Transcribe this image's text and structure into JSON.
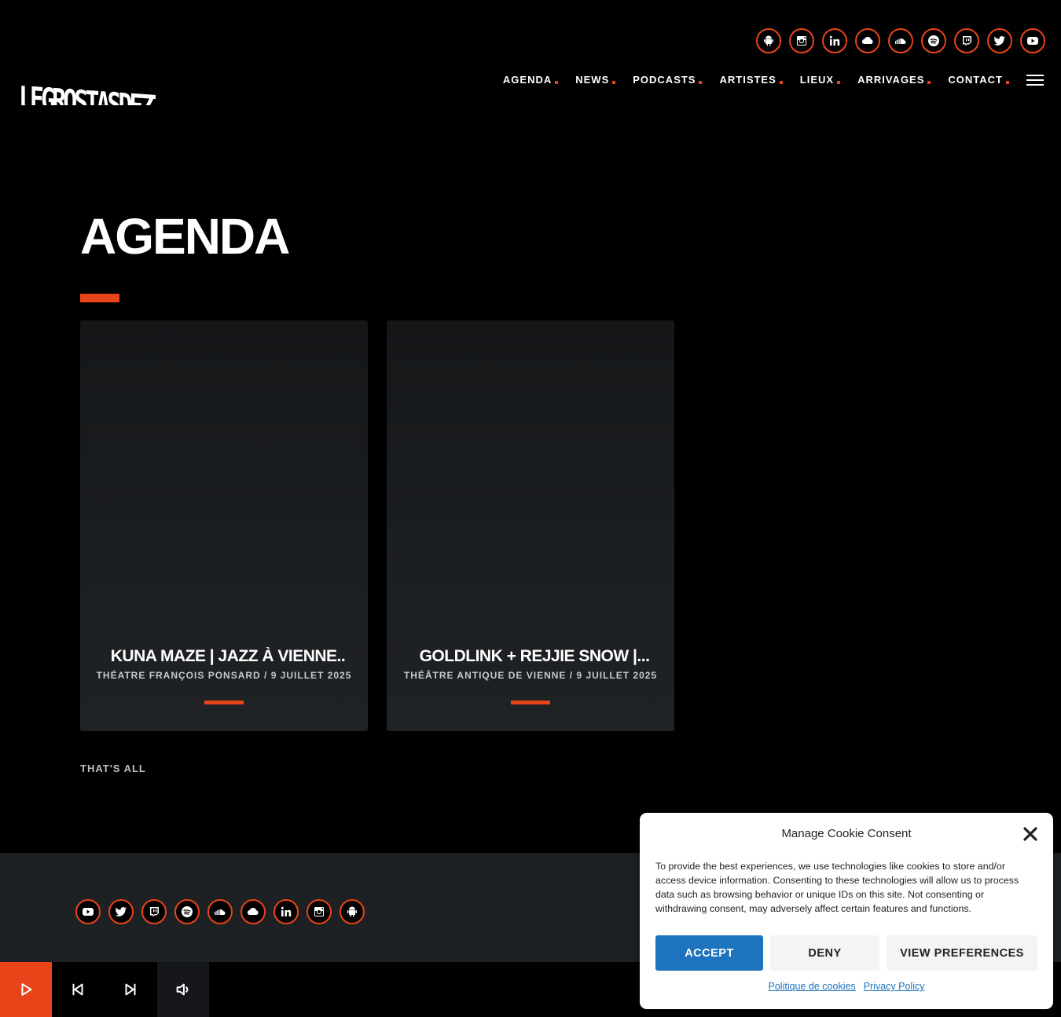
{
  "header": {
    "logo_text": "LEGROSTASDEZIK",
    "social": [
      "android-icon",
      "instagram-icon",
      "linkedin-icon",
      "mixcloud-icon",
      "soundcloud-icon",
      "spotify-icon",
      "twitch-icon",
      "twitter-icon",
      "youtube-icon"
    ],
    "nav": [
      "AGENDA",
      "NEWS",
      "PODCASTS",
      "ARTISTES",
      "LIEUX",
      "ARRIVAGES",
      "CONTACT"
    ]
  },
  "main": {
    "title": "AGENDA",
    "cards": [
      {
        "title": "KUNA MAZE | JAZZ À VIENNE..",
        "subtitle": "THÉATRE FRANÇOIS PONSARD / 9 JUILLET 2025"
      },
      {
        "title": "GOLDLINK + REJJIE SNOW |...",
        "subtitle": "THÉÂTRE ANTIQUE DE VIENNE / 9 JUILLET 2025"
      }
    ],
    "end_text": "THAT'S ALL"
  },
  "footer": {
    "social": [
      "youtube-icon",
      "twitter-icon",
      "twitch-icon",
      "spotify-icon",
      "soundcloud-icon",
      "mixcloud-icon",
      "linkedin-icon",
      "instagram-icon",
      "android-icon"
    ]
  },
  "cookie": {
    "title": "Manage Cookie Consent",
    "text": "To provide the best experiences, we use technologies like cookies to store and/or access device information. Consenting to these technologies will allow us to process data such as browsing behavior or unique IDs on this site. Not consenting or withdrawing consent, may adversely affect certain features and functions.",
    "accept": "ACCEPT",
    "deny": "DENY",
    "preferences": "VIEW PREFERENCES",
    "link_cookies": "Politique de cookies",
    "link_privacy": "Privacy Policy"
  },
  "colors": {
    "accent": "#e8441a",
    "accept_button": "#1e73be",
    "footer_bg": "#1e2124"
  }
}
